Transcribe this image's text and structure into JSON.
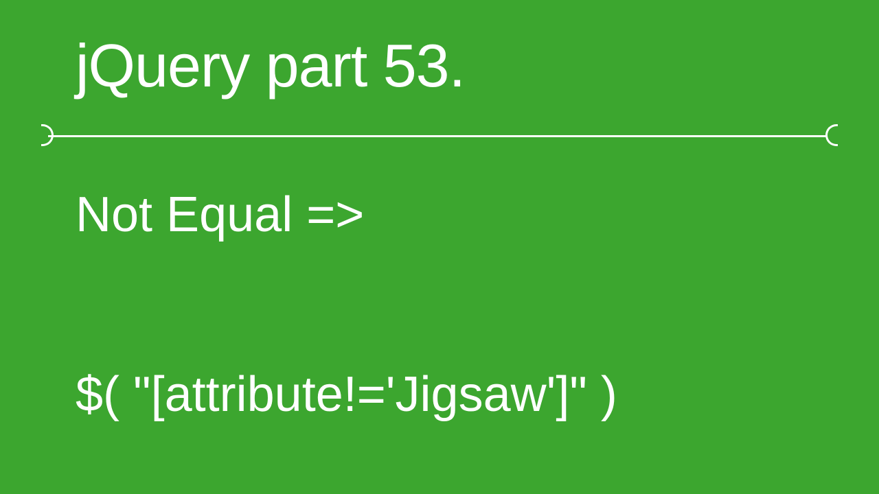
{
  "slide": {
    "title": "jQuery part 53.",
    "subtitle": "Not Equal  =>",
    "code": "$( \"[attribute!='Jigsaw']\" )"
  }
}
